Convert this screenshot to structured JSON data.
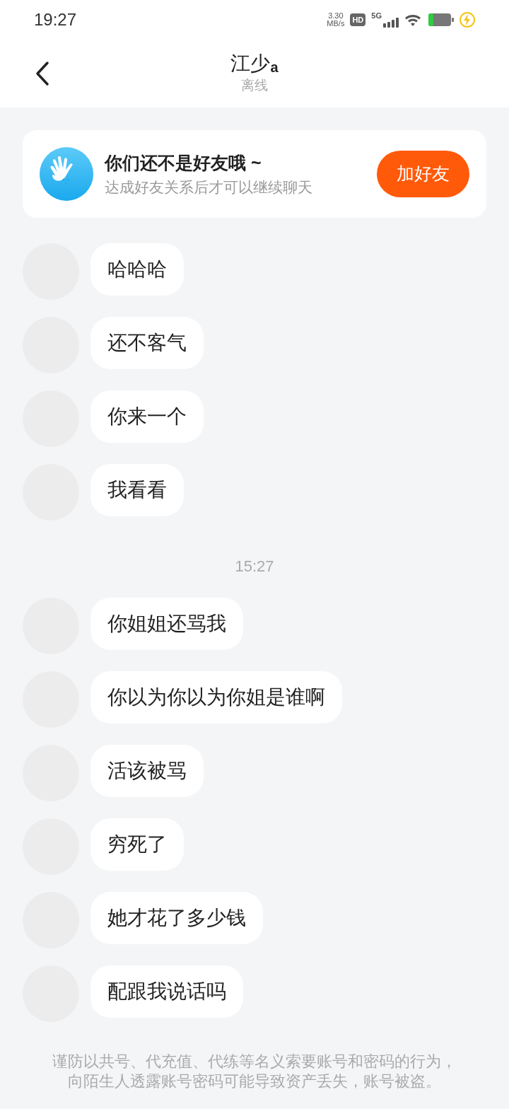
{
  "status_bar": {
    "time": "19:27",
    "speed": "3.30",
    "speed_unit": "MB/s",
    "hd": "HD",
    "network": "5G"
  },
  "header": {
    "title": "江少$_{a}$",
    "subtitle": "离线"
  },
  "friend_banner": {
    "title": "你们还不是好友哦 ~",
    "subtitle": "达成好友关系后才可以继续聊天",
    "button": "加好友"
  },
  "messages": [
    {
      "kind": "message",
      "text": "哈哈哈"
    },
    {
      "kind": "message",
      "text": "还不客气"
    },
    {
      "kind": "message",
      "text": "你来一个"
    },
    {
      "kind": "message",
      "text": "我看看"
    },
    {
      "kind": "time",
      "text": "15:27"
    },
    {
      "kind": "message",
      "text": "你姐姐还骂我"
    },
    {
      "kind": "message",
      "text": "你以为你以为你姐是谁啊"
    },
    {
      "kind": "message",
      "text": "活该被骂"
    },
    {
      "kind": "message",
      "text": "穷死了"
    },
    {
      "kind": "message",
      "text": "她才花了多少钱"
    },
    {
      "kind": "message",
      "text": "配跟我说话吗"
    }
  ],
  "warning": "谨防以共号、代充值、代练等名义索要账号和密码的行为，向陌生人透露账号密码可能导致资产丢失，账号被盗。"
}
